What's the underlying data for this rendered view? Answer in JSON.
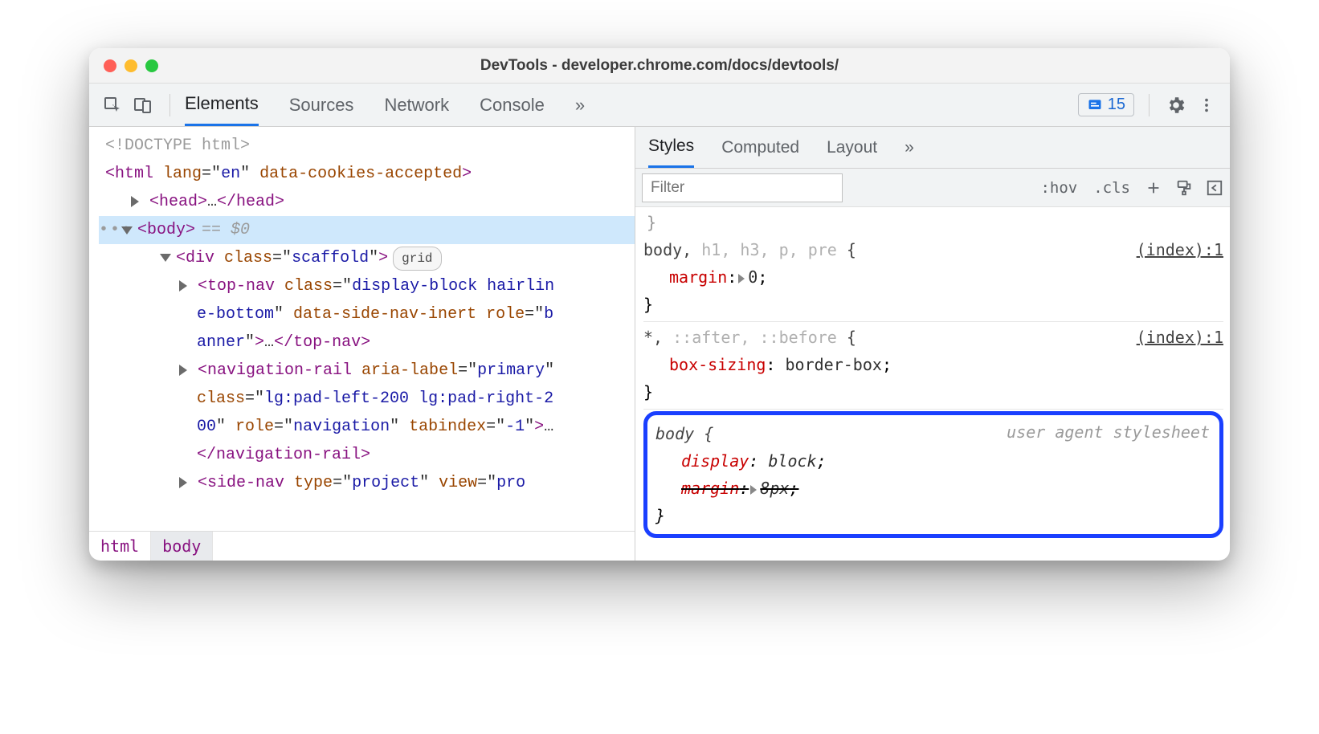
{
  "title": "DevTools - developer.chrome.com/docs/devtools/",
  "tabs": [
    "Elements",
    "Sources",
    "Network",
    "Console"
  ],
  "issues_count": "15",
  "dom": {
    "doctype": "<!DOCTYPE html>",
    "html_open": "<html lang=\"en\" data-cookies-accepted>",
    "head": "<head>…</head>",
    "body": "<body>",
    "eqdollar": "== $0",
    "div": "<div class=\"scaffold\">",
    "badge_grid": "grid",
    "topnav1": "<top-nav class=\"display-block hairlin",
    "topnav2": "e-bottom\" data-side-nav-inert role=\"b",
    "topnav3": "anner\">…</top-nav>",
    "navr1": "<navigation-rail aria-label=\"primary\"",
    "navr2": "class=\"lg:pad-left-200 lg:pad-right-2",
    "navr3": "00\" role=\"navigation\" tabindex=\"-1\">…",
    "navr4": "</navigation-rail>",
    "sidenav": "<side-nav type=\"project\" view=\"pro"
  },
  "crumbs": [
    "html",
    "body"
  ],
  "right_tabs": [
    "Styles",
    "Computed",
    "Layout"
  ],
  "filter": {
    "placeholder": "Filter",
    "hov": ":hov",
    "cls": ".cls"
  },
  "rules": [
    {
      "selector_parts": [
        {
          "text": "body, ",
          "grey": false
        },
        {
          "text": "h1, h3, p, pre",
          "grey": true
        },
        {
          "text": " {",
          "grey": false
        }
      ],
      "link": "(index):1",
      "props": [
        {
          "name": "margin",
          "value": "0",
          "triangle": true
        }
      ]
    },
    {
      "selector_parts": [
        {
          "text": "*, ",
          "grey": false
        },
        {
          "text": "::after, ::before",
          "grey": true
        },
        {
          "text": " {",
          "grey": false
        }
      ],
      "link": "(index):1",
      "props": [
        {
          "name": "box-sizing",
          "value": "border-box"
        }
      ]
    }
  ],
  "ua_rule": {
    "selector": "body {",
    "label": "user agent stylesheet",
    "props": [
      {
        "name": "display",
        "value": "block"
      },
      {
        "name": "margin",
        "value": "8px",
        "triangle": true,
        "strike": true
      }
    ]
  }
}
